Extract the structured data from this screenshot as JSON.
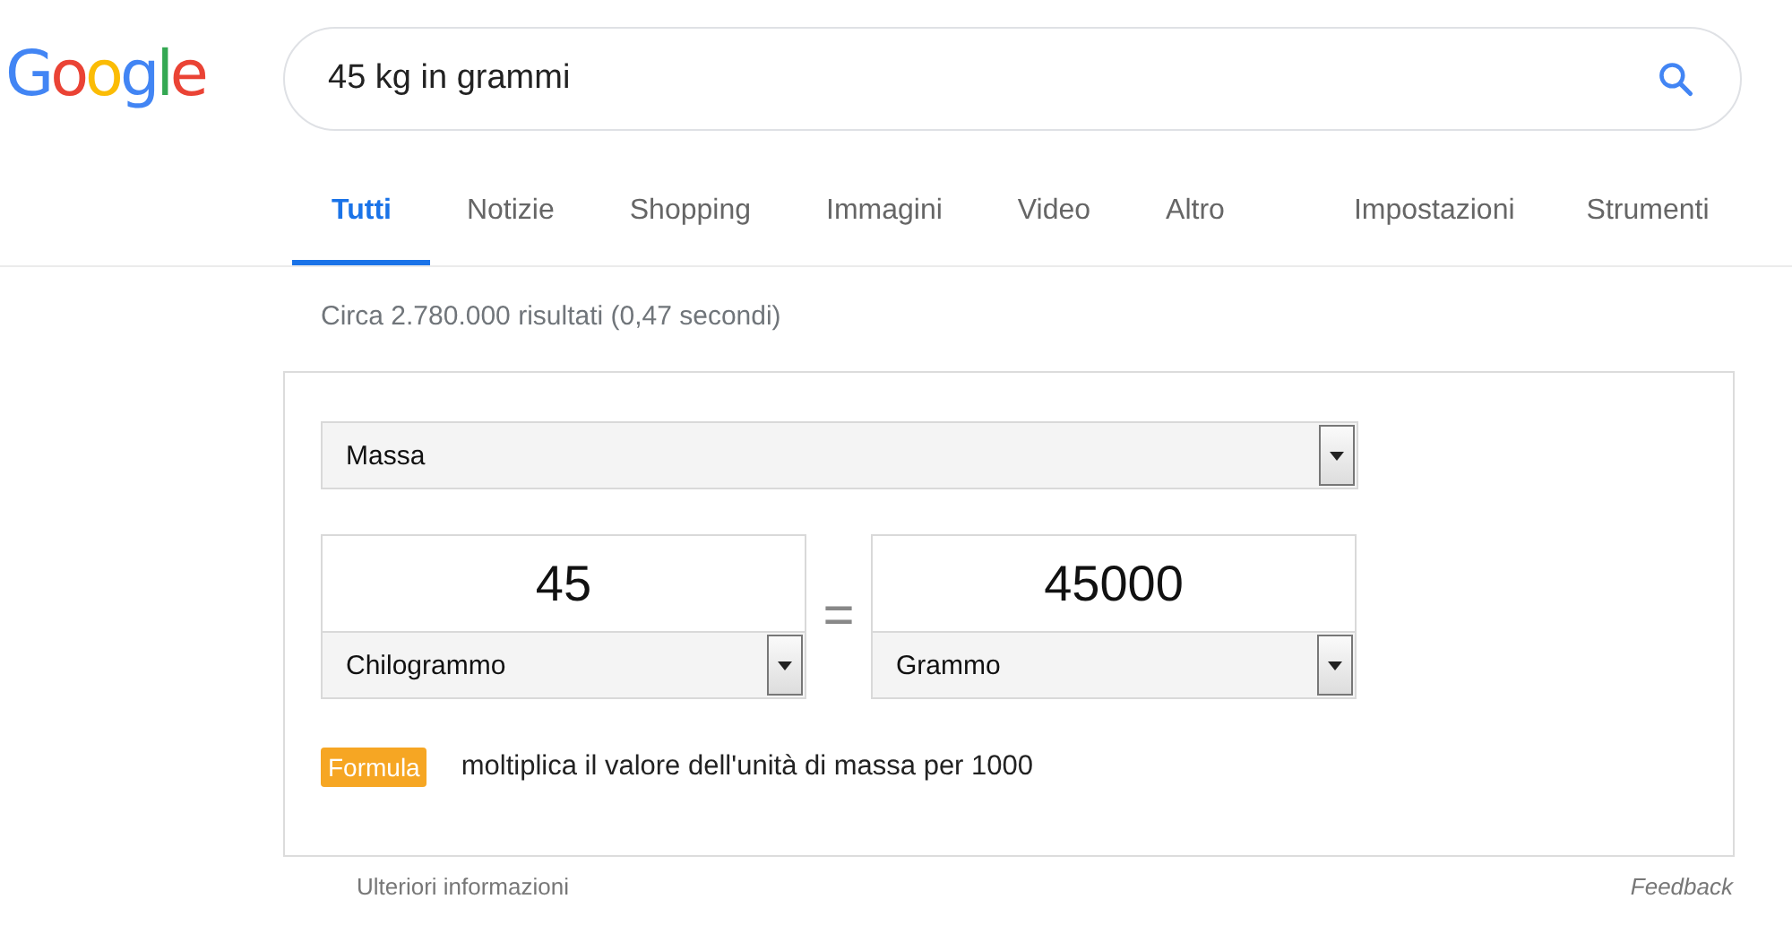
{
  "logo": "Google",
  "search": {
    "value": "45 kg in grammi"
  },
  "tabs": [
    {
      "label": "Tutti",
      "selected": true
    },
    {
      "label": "Notizie",
      "selected": false
    },
    {
      "label": "Shopping",
      "selected": false
    },
    {
      "label": "Immagini",
      "selected": false
    },
    {
      "label": "Video",
      "selected": false
    },
    {
      "label": "Altro",
      "selected": false
    }
  ],
  "tools": [
    "Impostazioni",
    "Strumenti"
  ],
  "result_stats": "Circa 2.780.000 risultati (0,47 secondi)",
  "converter": {
    "category": "Massa",
    "from": {
      "value": "45",
      "unit": "Chilogrammo"
    },
    "equals": "=",
    "to": {
      "value": "45000",
      "unit": "Grammo"
    },
    "formula_badge": "Formula",
    "formula": "moltiplica il valore dell'unità di massa per 1000"
  },
  "footer": {
    "more_info": "Ulteriori informazioni",
    "feedback": "Feedback"
  }
}
